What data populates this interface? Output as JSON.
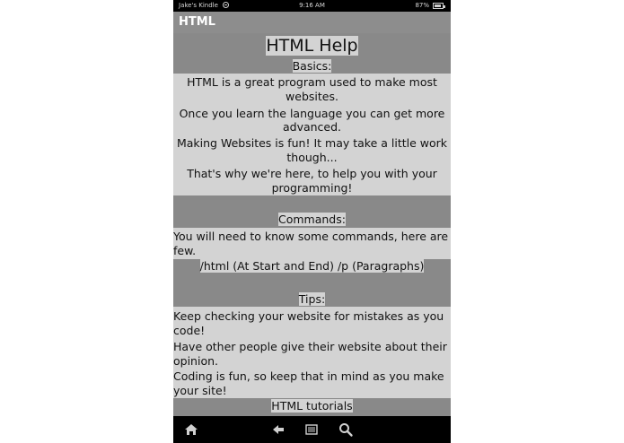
{
  "status_bar": {
    "device_owner": "Jake's Kindle",
    "time": "9:16 AM",
    "battery_percent": "87%",
    "battery_level": 0.87
  },
  "app_bar": {
    "title": "HTML"
  },
  "page": {
    "heading": "HTML Help",
    "basics": {
      "title": "Basics:",
      "lines": [
        "HTML is a great program used to make most",
        "websites.",
        "Once you learn the language you can get more",
        "advanced.",
        "Making Websites is fun! It may take a little work",
        "though...",
        "That's why we're here, to help you with your",
        "programming!"
      ]
    },
    "commands": {
      "title": "Commands:",
      "lines": [
        "You will need to know some commands, here are a",
        "few."
      ],
      "example": "/html (At Start and End) /p (Paragraphs)"
    },
    "tips": {
      "title": "Tips:",
      "lines": [
        "Keep checking your website for mistakes as you",
        "code!",
        "Have other people give their website about their",
        "opinion.",
        "Coding is fun, so keep that in mind as you make",
        "your site!"
      ]
    },
    "tutorials_title": "HTML tutorials"
  },
  "nav_bar": {
    "icons": [
      "home-icon",
      "back-icon",
      "menu-icon",
      "search-icon"
    ]
  },
  "colors": {
    "band": "#898989",
    "page_bg": "#d3d3d3",
    "title_bar": "#8d8d8d",
    "system_bar": "#000000"
  }
}
